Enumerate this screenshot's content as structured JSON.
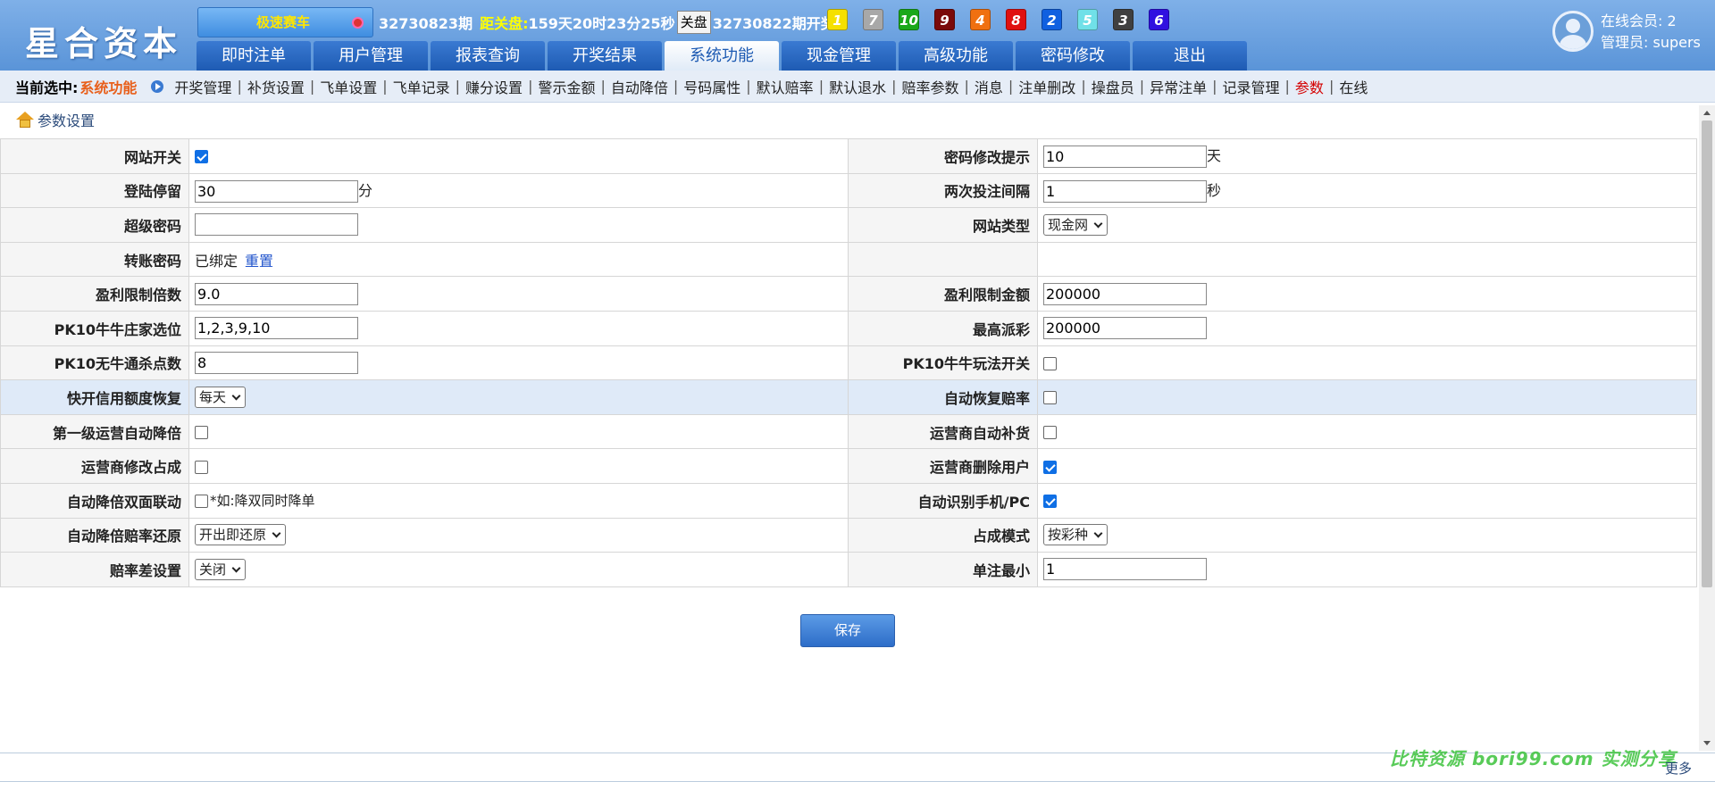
{
  "header": {
    "logo": "星合资本",
    "game_name": "极速赛车",
    "period_current": "32730823期",
    "countdown_label": "距关盘:",
    "countdown_value": "159天20时23分25秒",
    "close_button": "关盘",
    "last_period": "32730822期开奖:",
    "balls": [
      {
        "num": "1",
        "color": "#f5e000"
      },
      {
        "num": "7",
        "color": "#a8a8a8"
      },
      {
        "num": "10",
        "color": "#1aa81a"
      },
      {
        "num": "9",
        "color": "#7a0a0a"
      },
      {
        "num": "4",
        "color": "#f07010"
      },
      {
        "num": "8",
        "color": "#e01010"
      },
      {
        "num": "2",
        "color": "#1060e0"
      },
      {
        "num": "5",
        "color": "#70e0e8"
      },
      {
        "num": "3",
        "color": "#404040"
      },
      {
        "num": "6",
        "color": "#3010e0"
      }
    ],
    "nav_tabs": [
      "即时注单",
      "用户管理",
      "报表查询",
      "开奖结果",
      "系统功能",
      "现金管理",
      "高级功能",
      "密码修改",
      "退出"
    ],
    "active_tab": "系统功能",
    "online_label": "在线会员: 2",
    "admin_label": "管理员: supers"
  },
  "subnav": {
    "current_label": "当前选中:",
    "current_value": "系统功能",
    "items": [
      "开奖管理",
      "补货设置",
      "飞单设置",
      "飞单记录",
      "赚分设置",
      "警示金额",
      "自动降倍",
      "号码属性",
      "默认赔率",
      "默认退水",
      "赔率参数",
      "消息",
      "注单删改",
      "操盘员",
      "异常注单",
      "记录管理",
      "参数",
      "在线"
    ],
    "highlighted": "参数"
  },
  "breadcrumb": "参数设置",
  "rows": [
    {
      "l_label": "网站开关",
      "l_check": true,
      "r_label": "密码修改提示",
      "r_input": "10",
      "r_unit": "天"
    },
    {
      "l_label": "登陆停留",
      "l_input": "30",
      "l_unit": "分",
      "r_label": "两次投注间隔",
      "r_input": "1",
      "r_unit": "秒"
    },
    {
      "l_label": "超级密码",
      "l_input": "",
      "r_label": "网站类型",
      "r_select": "现金网"
    },
    {
      "l_label": "转账密码",
      "l_text": "已绑定",
      "l_link": "重置",
      "r_label": ""
    },
    {
      "l_label": "盈利限制倍数",
      "l_input": "9.0",
      "r_label": "盈利限制金额",
      "r_input": "200000"
    },
    {
      "l_label": "PK10牛牛庄家选位",
      "l_input": "1,2,3,9,10",
      "r_label": "最高派彩",
      "r_input": "200000"
    },
    {
      "l_label": "PK10无牛通杀点数",
      "l_input": "8",
      "r_label": "PK10牛牛玩法开关",
      "r_check": false
    },
    {
      "l_label": "快开信用额度恢复",
      "l_select": "每天",
      "r_label": "自动恢复赔率",
      "r_check": false
    },
    {
      "l_label": "第一级运营自动降倍",
      "l_check": false,
      "r_label": "运营商自动补货",
      "r_check": false
    },
    {
      "l_label": "运营商修改占成",
      "l_check": false,
      "r_label": "运营商删除用户",
      "r_check": true
    },
    {
      "l_label": "自动降倍双面联动",
      "l_check": false,
      "l_note": "*如:降双同时降单",
      "r_label": "自动识别手机/PC",
      "r_check": true
    },
    {
      "l_label": "自动降倍赔率还原",
      "l_select": "开出即还原",
      "r_label": "占成模式",
      "r_select": "按彩种"
    },
    {
      "l_label": "赔率差设置",
      "l_select": "关闭",
      "r_label": "单注最小",
      "r_input": "1"
    }
  ],
  "save_button": "保存",
  "watermark": "比特资源 bori99.com 实测分享",
  "more_link": "更多"
}
